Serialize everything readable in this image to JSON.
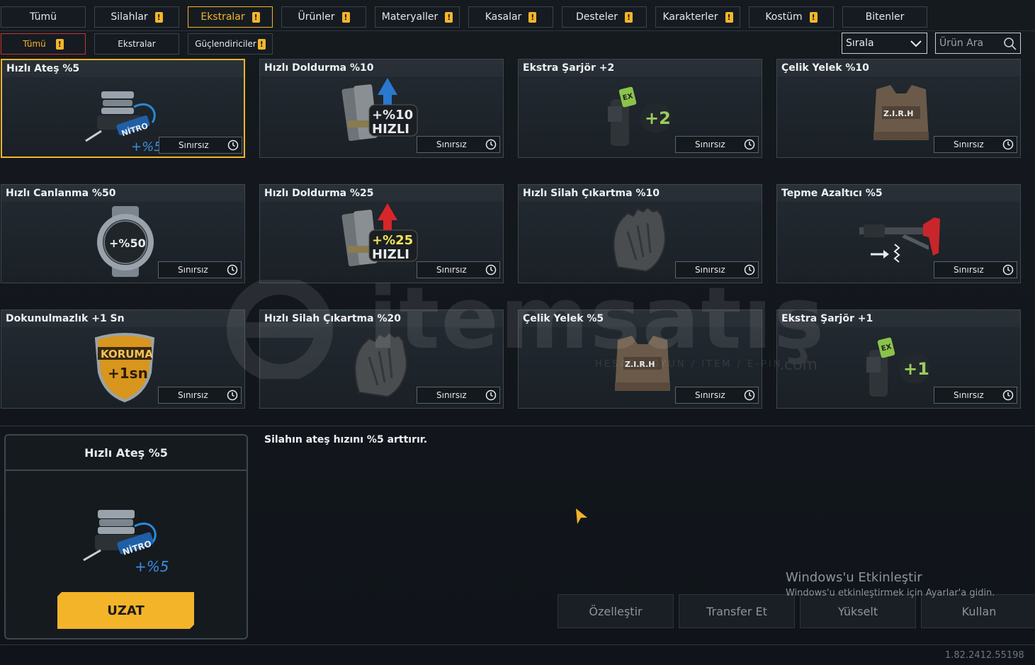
{
  "top_tabs": [
    {
      "label": "Tümü",
      "warn": false,
      "active": false
    },
    {
      "label": "Silahlar",
      "warn": true,
      "active": false
    },
    {
      "label": "Ekstralar",
      "warn": true,
      "active": true
    },
    {
      "label": "Ürünler",
      "warn": true,
      "active": false
    },
    {
      "label": "Materyaller",
      "warn": true,
      "active": false
    },
    {
      "label": "Kasalar",
      "warn": true,
      "active": false
    },
    {
      "label": "Desteler",
      "warn": true,
      "active": false
    },
    {
      "label": "Karakterler",
      "warn": true,
      "active": false
    },
    {
      "label": "Kostüm",
      "warn": true,
      "active": false
    },
    {
      "label": "Bitenler",
      "warn": false,
      "active": false
    }
  ],
  "warn_glyph": "!",
  "sub_tabs": [
    {
      "label": "Tümü",
      "warn": true,
      "active": true
    },
    {
      "label": "Ekstralar",
      "warn": false,
      "active": false
    },
    {
      "label": "Güçlendiriciler",
      "warn": true,
      "active": false
    }
  ],
  "sort": {
    "label": "Sırala"
  },
  "search": {
    "placeholder": "Ürün Ara"
  },
  "duration_label": "Sınırsız",
  "items": [
    {
      "title": "Hızlı Ateş %5",
      "icon": "nitro-engine-icon",
      "badge": "+%5",
      "selected": true
    },
    {
      "title": "Hızlı Doldurma %10",
      "icon": "magazine-speed-icon",
      "badge": "+%10 HIZLI",
      "selected": false
    },
    {
      "title": "Ekstra Şarjör +2",
      "icon": "mag-pouch-icon",
      "badge": "+2",
      "selected": false
    },
    {
      "title": "Çelik Yelek %10",
      "icon": "vest-icon",
      "badge": "Z.I.R.H",
      "selected": false
    },
    {
      "title": "Hızlı Canlanma %50",
      "icon": "watch-icon",
      "badge": "+%50",
      "selected": false
    },
    {
      "title": "Hızlı Doldurma %25",
      "icon": "magazine-speed-icon",
      "badge": "+%25 HIZLI",
      "selected": false
    },
    {
      "title": "Hızlı Silah Çıkartma %10",
      "icon": "glove-icon",
      "badge": "",
      "selected": false
    },
    {
      "title": "Tepme Azaltıcı %5",
      "icon": "stock-icon",
      "badge": "",
      "selected": false
    },
    {
      "title": "Dokunulmazlık +1 Sn",
      "icon": "shield-icon",
      "badge": "KORUMA +1sn",
      "selected": false
    },
    {
      "title": "Hızlı Silah Çıkartma %20",
      "icon": "glove-icon",
      "badge": "",
      "selected": false
    },
    {
      "title": "Çelik Yelek %5",
      "icon": "vest-icon",
      "badge": "Z.I.R.H",
      "selected": false
    },
    {
      "title": "Ekstra Şarjör +1",
      "icon": "mag-pouch-icon",
      "badge": "+1",
      "selected": false
    }
  ],
  "detail": {
    "title": "Hızlı Ateş %5",
    "badge": "+%5",
    "description": "Silahın ateş hızını %5 arttırır.",
    "primary_button": "UZAT"
  },
  "actions": [
    "Özelleştir",
    "Transfer Et",
    "Yükselt",
    "Kullan"
  ],
  "windows_notice": {
    "title": "Windows'u Etkinleştir",
    "subtitle": "Windows'u etkinleştirmek için Ayarlar'a gidin."
  },
  "watermark": {
    "brand": "itemsatış",
    "tagline": "HESAP / OYUN / ITEM / E-PIN",
    "domain": ".com"
  },
  "version": "1.82.2412.55198",
  "colors": {
    "accent": "#f2b52a",
    "active_sub_border": "#c73532",
    "panel_border": "#3d464f"
  }
}
